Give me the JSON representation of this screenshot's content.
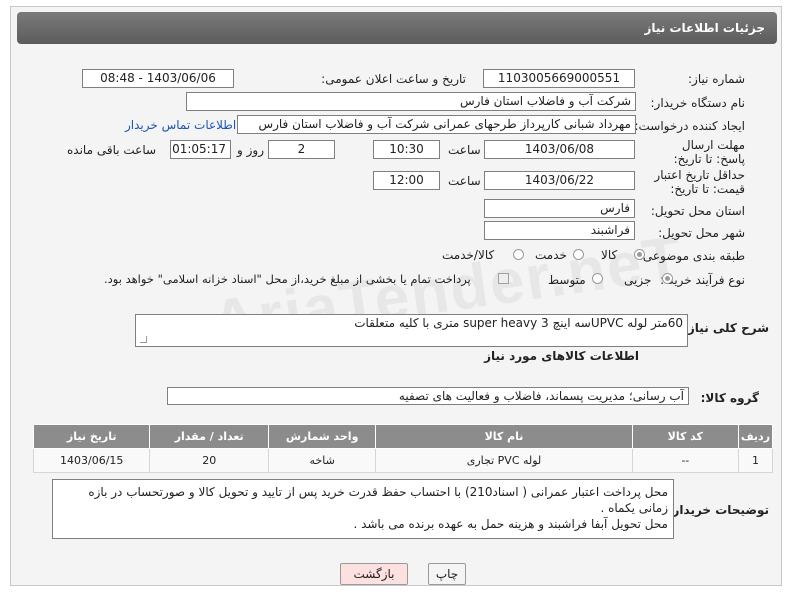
{
  "header": {
    "title": "جزئیات اطلاعات نیاز"
  },
  "form": {
    "need_number": {
      "label": "شماره نیاز:",
      "value": "1103005669000551"
    },
    "announce_datetime": {
      "label": "تاریخ و ساعت اعلان عمومی:",
      "value": "1403/06/06 - 08:48"
    },
    "buyer_org": {
      "label": "نام دستگاه خریدار:",
      "value": "شرکت آب و فاضلاب استان فارس"
    },
    "requester": {
      "label": "ایجاد کننده درخواست:",
      "value": "مهرداد شبانی کارپرداز طرحهای عمرانی  شرکت آب و فاضلاب استان فارس",
      "contact_link": "اطلاعات تماس خریدار"
    },
    "reply_deadline": {
      "label": "مهلت ارسال پاسخ: تا تاریخ:",
      "date": "1403/06/08",
      "time_label": "ساعت",
      "time": "10:30",
      "days": "2",
      "days_label": "روز و",
      "remaining": "01:05:17",
      "remaining_label": "ساعت باقی مانده"
    },
    "price_validity": {
      "label": "حداقل تاریخ اعتبار قیمت: تا تاریخ:",
      "date": "1403/06/22",
      "time_label": "ساعت",
      "time": "12:00"
    },
    "province": {
      "label": "استان محل تحویل:",
      "value": "فارس"
    },
    "city": {
      "label": "شهر محل تحویل:",
      "value": "فراشبند"
    },
    "category": {
      "label": "طبقه بندی موضوعی:",
      "options": [
        "کالا",
        "خدمت",
        "کالا/خدمت"
      ],
      "selected": "کالا"
    },
    "process_type": {
      "label": "نوع فرآیند خرید :",
      "options": [
        "جزیی",
        "متوسط"
      ],
      "note": "پرداخت تمام یا بخشی از مبلغ خرید،از محل \"اسناد خزانه اسلامی\" خواهد بود."
    },
    "description": {
      "label": "شرح کلی نیاز:",
      "value": "60متر لوله UPVCسه اینچ super heavy 3 متری با کلیه متعلقات"
    }
  },
  "goods_section": {
    "title": "اطلاعات کالاهای مورد نیاز",
    "group_label": "گروه کالا:",
    "group_value": "آب رسانی؛ مدیریت پسماند، فاضلاب و فعالیت های تصفیه"
  },
  "table": {
    "columns": [
      "ردیف",
      "کد کالا",
      "نام کالا",
      "واحد شمارش",
      "تعداد / مقدار",
      "تاریخ نیاز"
    ],
    "rows": [
      [
        "1",
        "--",
        "لوله PVC تجاری",
        "شاخه",
        "20",
        "1403/06/15"
      ]
    ]
  },
  "buyer_notes": {
    "label": "توضیحات خریدار:",
    "lines": [
      "محل پرداخت اعتبار عمرانی ( اسناد210) با احتساب حفظ قدرت خرید پس از تایید و تحویل کالا و صورتحساب در بازه زمانی یکماه .",
      "محل تحویل  آبفا فراشبند  و هزینه حمل به عهده برنده می باشد ."
    ]
  },
  "buttons": {
    "print": "چاپ",
    "back": "بازگشت"
  },
  "watermark": "AriaTender.neT",
  "colors": {
    "header_bg": "#6b6b6b",
    "table_header_bg": "#8c8c8c",
    "link": "#1a56b8",
    "back_button_bg": "#fde0e0"
  }
}
